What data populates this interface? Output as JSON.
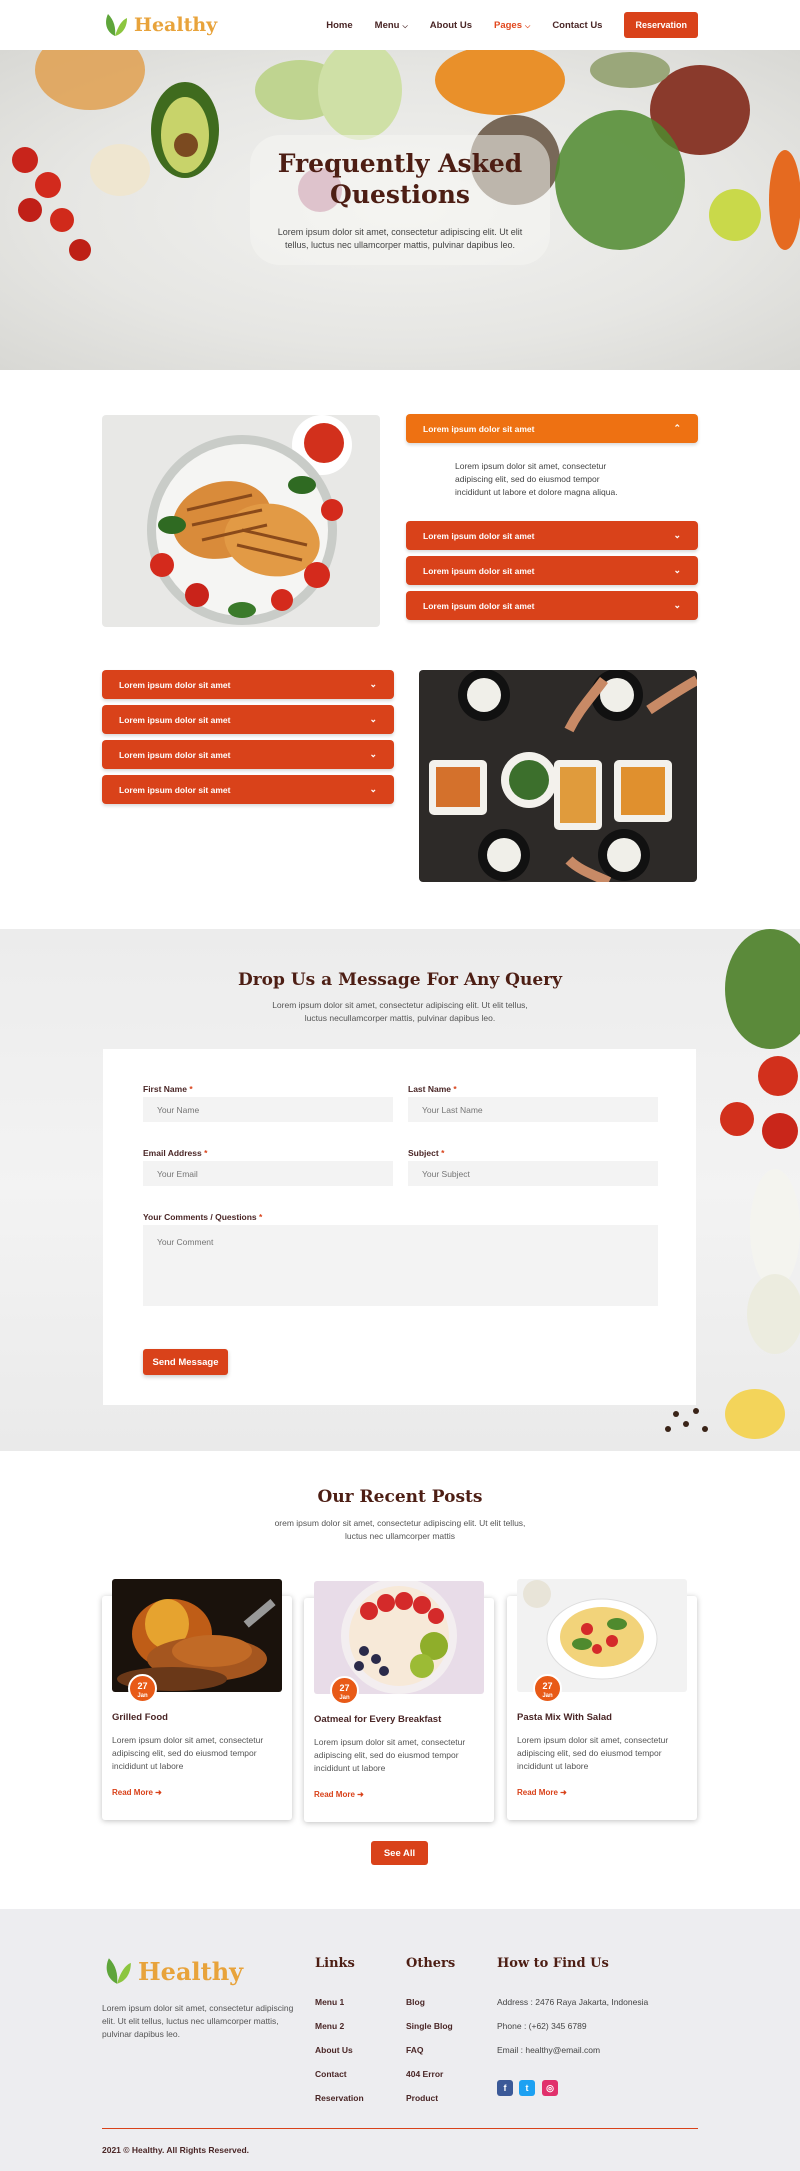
{
  "header": {
    "logo_text": "Healthy",
    "nav": [
      {
        "label": "Home"
      },
      {
        "label": "Menu"
      },
      {
        "label": "About Us"
      },
      {
        "label": "Pages"
      },
      {
        "label": "Contact Us"
      }
    ],
    "reservation_label": "Reservation",
    "accent_color": "#d9421a",
    "logo_color": "#e8a33b"
  },
  "hero": {
    "title_line1": "Frequently Asked",
    "title_line2": "Questions",
    "subtitle": "Lorem ipsum dolor sit amet, consectetur adipiscing elit. Ut elit tellus, luctus nec ullamcorper mattis, pulvinar dapibus leo."
  },
  "faq": {
    "group1": [
      {
        "question": "Lorem ipsum dolor sit amet",
        "open": true
      },
      {
        "question": "Lorem ipsum dolor sit amet",
        "open": false
      },
      {
        "question": "Lorem ipsum dolor sit amet",
        "open": false
      },
      {
        "question": "Lorem ipsum dolor sit amet",
        "open": false
      }
    ],
    "answer": "Lorem ipsum dolor sit amet, consectetur adipiscing elit, sed do eiusmod tempor incididunt ut labore et dolore magna aliqua.",
    "group2": [
      {
        "question": "Lorem ipsum dolor sit amet"
      },
      {
        "question": "Lorem ipsum dolor sit amet"
      },
      {
        "question": "Lorem ipsum dolor sit amet"
      },
      {
        "question": "Lorem ipsum dolor sit amet"
      }
    ]
  },
  "contact": {
    "title": "Drop Us a Message For Any Query",
    "subtitle": "Lorem ipsum dolor sit amet, consectetur adipiscing elit. Ut elit tellus, luctus necullamcorper mattis, pulvinar dapibus leo.",
    "first_name_label": "First Name",
    "first_name_placeholder": "Your Name",
    "last_name_label": "Last Name",
    "last_name_placeholder": "Your Last Name",
    "email_label": "Email Address",
    "email_placeholder": "Your Email",
    "subject_label": "Subject",
    "subject_placeholder": "Your Subject",
    "comments_label": "Your Comments / Questions",
    "comments_placeholder": "Your Comment",
    "required_mark": "*",
    "send_label": "Send Message"
  },
  "posts": {
    "title": "Our Recent Posts",
    "subtitle": "orem ipsum dolor sit amet, consectetur adipiscing elit. Ut elit tellus, luctus nec ullamcorper mattis",
    "items": [
      {
        "title": "Grilled Food",
        "day": "27",
        "month": "Jan",
        "text": "Lorem ipsum dolor sit amet, consectetur adipiscing elit, sed do eiusmod tempor incididunt ut labore",
        "more": "Read More"
      },
      {
        "title": "Oatmeal for Every Breakfast",
        "day": "27",
        "month": "Jan",
        "text": "Lorem ipsum dolor sit amet, consectetur adipiscing elit, sed do eiusmod tempor incididunt ut labore",
        "more": "Read More"
      },
      {
        "title": "Pasta Mix With Salad",
        "day": "27",
        "month": "Jan",
        "text": "Lorem ipsum dolor sit amet, consectetur adipiscing elit, sed do eiusmod tempor incididunt ut labore",
        "more": "Read More"
      }
    ],
    "see_all_label": "See All"
  },
  "footer": {
    "logo_text": "Healthy",
    "about": "Lorem ipsum dolor sit amet, consectetur adipiscing elit. Ut elit tellus, luctus nec ullamcorper mattis, pulvinar dapibus leo.",
    "links_title": "Links",
    "links": [
      "Menu 1",
      "Menu 2",
      "About Us",
      "Contact",
      "Reservation"
    ],
    "others_title": "Others",
    "others": [
      "Blog",
      "Single Blog",
      "FAQ",
      "404 Error",
      "Product"
    ],
    "find_title": "How to Find Us",
    "address": "Address : 2476 Raya Jakarta, Indonesia",
    "phone": "Phone : (+62) 345 6789",
    "email": "Email : healthy@email.com",
    "social": [
      {
        "icon": "facebook-icon",
        "glyph": "f",
        "color": "#3b5998"
      },
      {
        "icon": "twitter-icon",
        "glyph": "t",
        "color": "#1da1f2"
      },
      {
        "icon": "instagram-icon",
        "glyph": "◎",
        "color": "#e1306c"
      }
    ],
    "copyright": "2021 © Healthy. All Rights Reserved."
  }
}
